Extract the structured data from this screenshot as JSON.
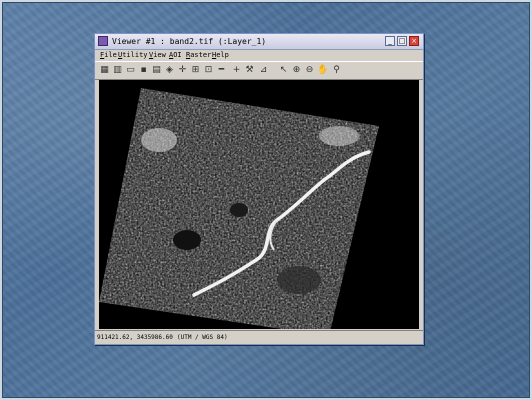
{
  "window": {
    "title": "Viewer #1 : band2.tif (:Layer_1)",
    "buttons": [
      "minimize",
      "maximize",
      "close"
    ]
  },
  "menubar": {
    "items": [
      "File",
      "Utility",
      "View",
      "AOI",
      "Raster",
      "Help"
    ]
  },
  "toolbar": {
    "tools": [
      {
        "name": "open-file-icon",
        "glyph": "▦"
      },
      {
        "name": "open-folder-icon",
        "glyph": "▥"
      },
      {
        "name": "new-page-icon",
        "glyph": "▭"
      },
      {
        "name": "save-icon",
        "glyph": "▪"
      },
      {
        "name": "print-icon",
        "glyph": "▤"
      },
      {
        "name": "eraser-icon",
        "glyph": "◈"
      },
      {
        "name": "target-icon",
        "glyph": "✛"
      },
      {
        "name": "grid-icon",
        "glyph": "⊞"
      },
      {
        "name": "fit-icon",
        "glyph": "⊡"
      },
      {
        "name": "minus-icon",
        "glyph": "━"
      },
      {
        "name": "crosshair-icon",
        "glyph": "+"
      },
      {
        "name": "hammer-icon",
        "glyph": "⚒"
      },
      {
        "name": "chart-icon",
        "glyph": "⊿"
      },
      {
        "name": "pointer-icon",
        "glyph": "↖"
      },
      {
        "name": "zoom-in-icon",
        "glyph": "⊕"
      },
      {
        "name": "zoom-out-icon",
        "glyph": "⊖"
      },
      {
        "name": "pan-hand-icon",
        "glyph": "✋"
      },
      {
        "name": "inquire-icon",
        "glyph": "⚲"
      }
    ]
  },
  "image": {
    "description_color": "#000000"
  },
  "status": {
    "coordinates": "911421.62, 3435986.60",
    "projection": "(UTM / WGS 84)"
  },
  "colors": {
    "background_blue": "#5a7ea6",
    "window_gray": "#d4d0c8",
    "close_red": "#d9443a",
    "viewport_black": "#000000"
  }
}
